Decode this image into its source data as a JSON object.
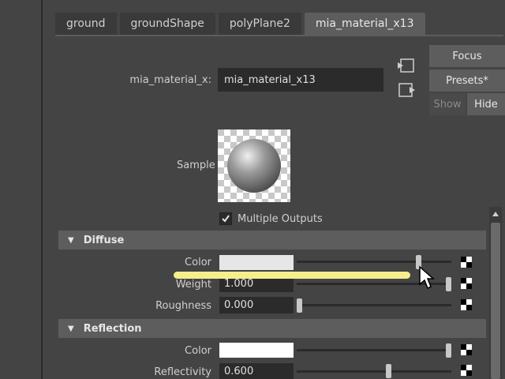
{
  "tabs": [
    {
      "label": "ground",
      "active": false
    },
    {
      "label": "groundShape",
      "active": false
    },
    {
      "label": "polyPlane2",
      "active": false
    },
    {
      "label": "mia_material_x13",
      "active": true
    }
  ],
  "header": {
    "name_label": "mia_material_x:",
    "name_value": "mia_material_x13"
  },
  "side_buttons": {
    "focus": "Focus",
    "presets": "Presets*",
    "show": "Show",
    "hide": "Hide"
  },
  "sample": {
    "label": "Sample"
  },
  "multiple_outputs": {
    "label": "Multiple Outputs",
    "checked": true
  },
  "sections": {
    "diffuse": {
      "title": "Diffuse",
      "color_label": "Color",
      "color_value": "#e6e6e6",
      "color_slider": 0.8,
      "weight_label": "Weight",
      "weight_value": "1.000",
      "weight_slider": 1.0,
      "roughness_label": "Roughness",
      "roughness_value": "0.000",
      "roughness_slider": 0.0
    },
    "reflection": {
      "title": "Reflection",
      "color_label": "Color",
      "color_value": "#ffffff",
      "color_slider": 1.0,
      "reflectivity_label": "Reflectivity",
      "reflectivity_value": "0.600",
      "reflectivity_slider": 0.6
    }
  },
  "colors": {
    "panel_bg": "#444444",
    "field_bg": "#2b2b2b",
    "header_bg": "#5d5d5d",
    "highlight": "#f4ee8e"
  }
}
